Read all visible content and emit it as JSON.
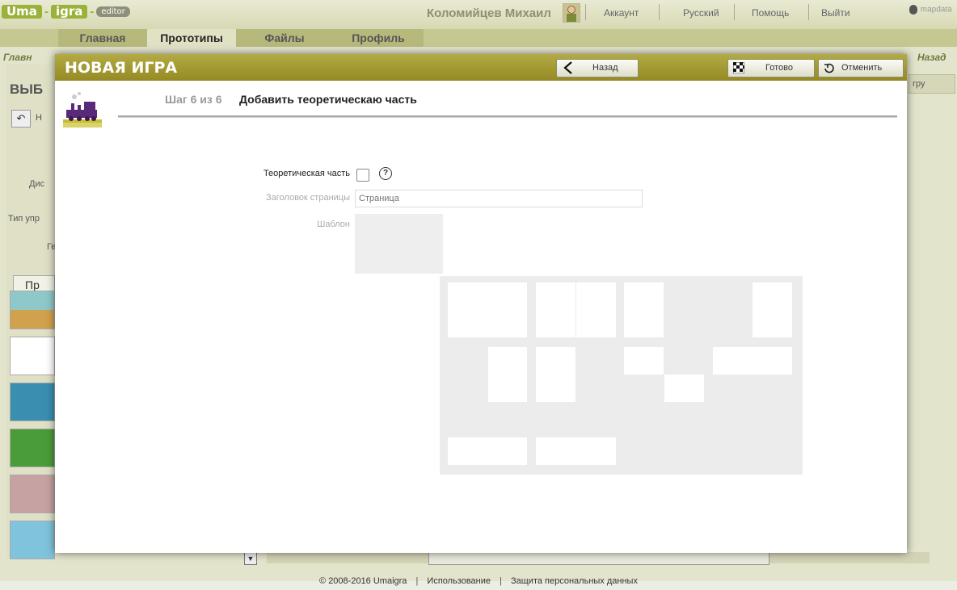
{
  "header": {
    "logo": {
      "part1": "Uma",
      "part2": "igra",
      "badge": "editor"
    },
    "user_name": "Коломийцев Михаил",
    "links": [
      "Аккаунт",
      "Русский",
      "Помощь",
      "Выйти"
    ],
    "mapdata": "mapdata"
  },
  "nav": {
    "tabs": [
      "Главная",
      "Прототипы",
      "Файлы",
      "Профиль"
    ],
    "active_index": 1
  },
  "background": {
    "breadcrumb": "Главн",
    "back": "Назад",
    "title": "ВЫБ",
    "labels": [
      "Дис",
      "Тип упр",
      "Ге"
    ],
    "tab_label": "Пр",
    "right_btn": "гру",
    "icon_left": "Н"
  },
  "modal": {
    "title": "НОВАЯ ИГРА",
    "back_label": "Назад",
    "done_label": "Готово",
    "cancel_label": "Отменить",
    "step_number": "Шаг 6 из 6",
    "step_title": "Добавить теоретическаю часть",
    "fields": {
      "theory_label": "Теоретическая часть",
      "theory_checked": false,
      "help_symbol": "?",
      "page_title_label": "Заголовок страницы",
      "page_title_placeholder": "Страница",
      "template_label": "Шаблон"
    }
  },
  "footer": {
    "copyright": "© 2008-2016 Umaigra",
    "links": [
      "Использование",
      "Защита персональных данных"
    ]
  },
  "colors": {
    "accent": "#9bb23a",
    "modal_header": "#a59d35",
    "nav": "#c5c891"
  }
}
